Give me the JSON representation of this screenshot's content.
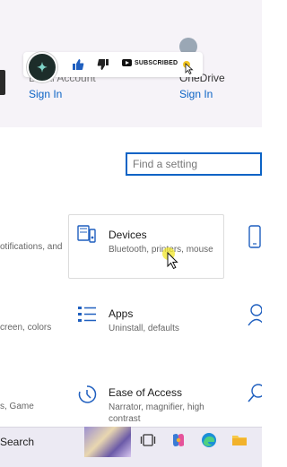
{
  "header": {
    "local_account_label": "Local Account",
    "sign_in_left": "Sign In",
    "onedrive_label": "OneDrive",
    "sign_in_right": "Sign In"
  },
  "banner": {
    "subscribe_label": "SUBSCRIBED"
  },
  "search": {
    "placeholder": "Find a setting"
  },
  "left_column": {
    "items": [
      "otifications, and",
      "creen, colors",
      "s, Game"
    ]
  },
  "tiles": {
    "devices": {
      "title": "Devices",
      "desc": "Bluetooth, printers, mouse"
    },
    "apps": {
      "title": "Apps",
      "desc": "Uninstall, defaults"
    },
    "ease": {
      "title": "Ease of Access",
      "desc": "Narrator, magnifier, high contrast"
    }
  },
  "taskbar": {
    "search_label": "Search"
  },
  "colors": {
    "accent": "#0b63c5",
    "header_bg": "#f6f3f8",
    "taskbar_bg": "#eceaf3"
  }
}
